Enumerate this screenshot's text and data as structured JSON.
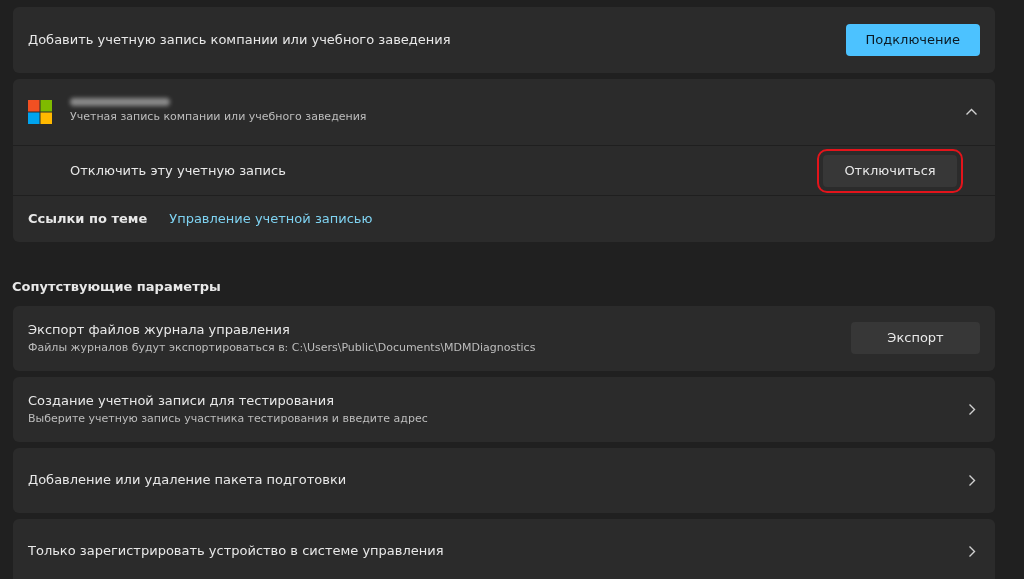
{
  "add_account": {
    "label": "Добавить учетную запись компании или учебного заведения",
    "button": "Подключение"
  },
  "account": {
    "name_redacted": true,
    "subtitle": "Учетная запись компании или учебного заведения",
    "expanded": true,
    "disconnect": {
      "label": "Отключить эту учетную запись",
      "button": "Отключиться",
      "highlighted": true
    },
    "links": {
      "label": "Ссылки по теме",
      "link": "Управление учетной записью"
    }
  },
  "related": {
    "heading": "Сопутствующие параметры",
    "items": [
      {
        "kind": "button",
        "title": "Экспорт файлов журнала управления",
        "subtitle": "Файлы журналов будут экспортироваться в: C:\\Users\\Public\\Documents\\MDMDiagnostics",
        "button": "Экспорт"
      },
      {
        "kind": "link",
        "title": "Создание учетной записи для тестирования",
        "subtitle": "Выберите учетную запись участника тестирования и введите адрес"
      },
      {
        "kind": "link",
        "title": "Добавление или удаление пакета подготовки"
      },
      {
        "kind": "link",
        "title": "Только зарегистрировать устройство в системе управления"
      }
    ]
  }
}
